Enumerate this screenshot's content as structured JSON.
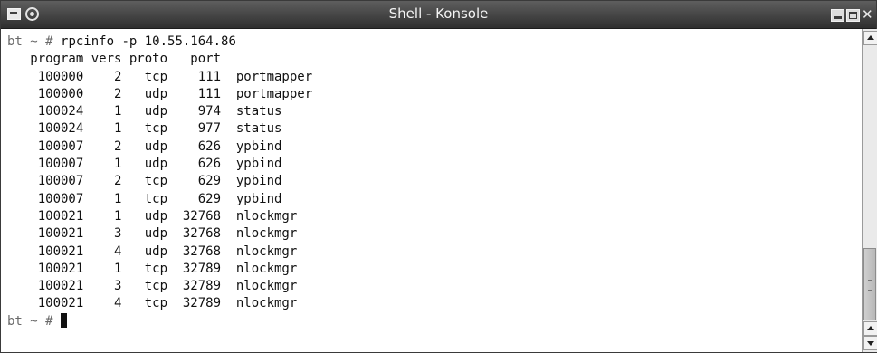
{
  "window": {
    "title": "Shell - Konsole",
    "close_glyph": "✕",
    "icons": [
      "terminal-app-icon",
      "sticky-icon",
      "minimize-icon",
      "maximize-icon",
      "close-icon"
    ]
  },
  "terminal": {
    "prompt": "bt ~ #",
    "command": "rpcinfo -p 10.55.164.86",
    "header": "   program vers proto   port",
    "rows": [
      "    100000    2   tcp    111  portmapper",
      "    100000    2   udp    111  portmapper",
      "    100024    1   udp    974  status",
      "    100024    1   tcp    977  status",
      "    100007    2   udp    626  ypbind",
      "    100007    1   udp    626  ypbind",
      "    100007    2   tcp    629  ypbind",
      "    100007    1   tcp    629  ypbind",
      "    100021    1   udp  32768  nlockmgr",
      "    100021    3   udp  32768  nlockmgr",
      "    100021    4   udp  32768  nlockmgr",
      "    100021    1   tcp  32789  nlockmgr",
      "    100021    3   tcp  32789  nlockmgr",
      "    100021    4   tcp  32789  nlockmgr"
    ],
    "final_prompt": "bt ~ #"
  },
  "colors": {
    "titlebar": "#3c3c3c",
    "terminal_bg": "#ffffff",
    "terminal_fg": "#111111",
    "prompt": "#6a6a6a"
  }
}
